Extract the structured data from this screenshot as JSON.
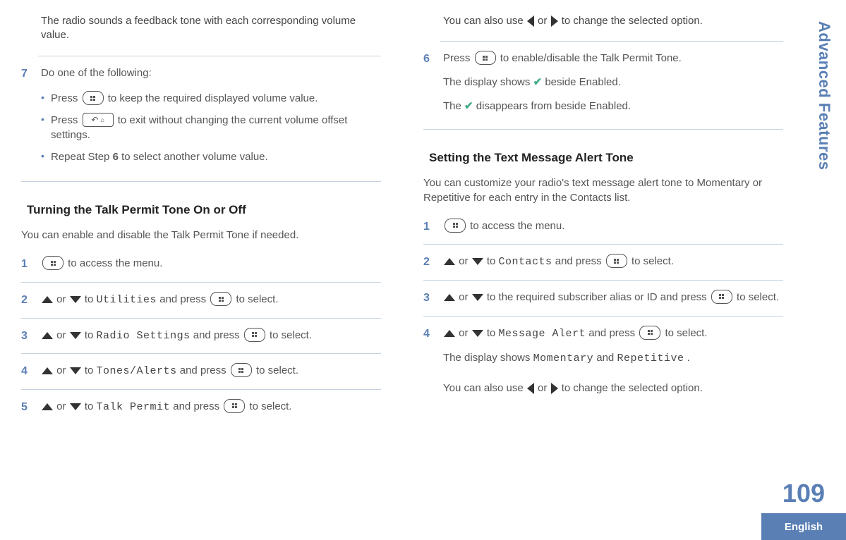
{
  "sidebar_title": "Advanced Features",
  "page_number": "109",
  "language": "English",
  "left": {
    "intro_para": "The radio sounds a feedback tone with each corresponding volume value.",
    "step7_num": "7",
    "step7_text": "Do one of the following:",
    "bullets": {
      "b1a": "Press ",
      "b1b": " to keep the required displayed volume value.",
      "b2a": "Press ",
      "b2b": " to exit without changing the current volume offset settings.",
      "b3_prefix": "Repeat Step ",
      "b3_bold": "6",
      "b3_suffix": " to select another volume value."
    },
    "section2_title": "Turning the Talk Permit Tone On or Off",
    "section2_lead": "You can enable and disable the Talk Permit Tone if needed.",
    "s1": {
      "num": "1",
      "suffix": " to access the menu."
    },
    "s2": {
      "num": "2",
      "prefix": " or ",
      "mid": " to ",
      "menu": "Utilities",
      "mid2": " and press ",
      "suffix": " to select."
    },
    "s3": {
      "num": "3",
      "prefix": " or ",
      "mid": " to ",
      "menu": "Radio Settings",
      "mid2": " and press ",
      "suffix": " to select."
    },
    "s4": {
      "num": "4",
      "prefix": " or ",
      "mid": " to ",
      "menu": "Tones/Alerts",
      "mid2": " and press ",
      "suffix": " to select."
    },
    "s5": {
      "num": "5",
      "prefix": " or ",
      "mid": " to ",
      "menu": "Talk Permit",
      "mid2": " and press ",
      "suffix": " to select."
    }
  },
  "right": {
    "line1a": "You can also use ",
    "line1b": " or ",
    "line1c": " to change the selected option.",
    "s6": {
      "num": "6",
      "a": "Press ",
      "b": " to enable/disable the Talk Permit Tone.",
      "c1": "The display shows ",
      "c2": " beside Enabled.",
      "d1": "The ",
      "d2": " disappears from beside Enabled."
    },
    "section_title": "Setting the Text Message Alert Tone",
    "lead": "You can customize your radio's text message alert tone to Momentary or Repetitive for each entry in the Contacts list.",
    "r1": {
      "num": "1",
      "suffix": " to access the menu."
    },
    "r2": {
      "num": "2",
      "prefix": " or ",
      "mid": " to ",
      "menu": "Contacts",
      "mid2": " and press ",
      "suffix": " to select."
    },
    "r3": {
      "num": "3",
      "prefix": " or ",
      "mid": " to the required subscriber alias or ID and press ",
      "suffix": " to select."
    },
    "r4": {
      "num": "4",
      "prefix": " or ",
      "mid": " to ",
      "menu": "Message Alert",
      "mid2": " and press ",
      "suffix": " to select.",
      "disp_a": "The display shows ",
      "disp_m1": "Momentary",
      "disp_b": " and ",
      "disp_m2": "Repetitive",
      "disp_c": ".",
      "also_a": "You can also use ",
      "also_b": " or ",
      "also_c": " to change the selected option."
    }
  }
}
